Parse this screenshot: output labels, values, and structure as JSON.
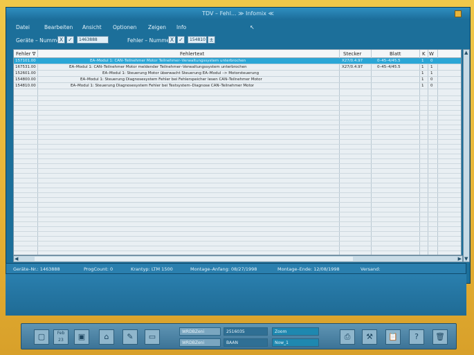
{
  "window": {
    "title": "TDV – Fehl... ≫ Infomix ≪"
  },
  "menu": [
    "Datei",
    "Bearbeiten",
    "Ansicht",
    "Optionen",
    "Zeigen",
    "Info"
  ],
  "filter": {
    "geraete_label": "Geräte – Nummer",
    "geraete_value": "1463888",
    "fehler_label": "Fehler – Nummer",
    "fehler_value": "154810",
    "check_mark": "✓",
    "x_mark": "X"
  },
  "table": {
    "headers": {
      "fehler": "Fehler ∇",
      "text": "Fehlertext",
      "stecker": "Stecker",
      "blatt": "Blatt",
      "k": "K",
      "w": "W"
    },
    "rows": [
      {
        "id": "157101.00",
        "text": "EA–Modul 1: CAN–Teilnehmer Motor Teilnehmer–Verwaltungssystem unterbrochen",
        "stecker": "X27/0.4.97",
        "blatt": "0–45–4/45.5",
        "k": "1",
        "w": "0",
        "selected": true
      },
      {
        "id": "167531.00",
        "text": "EA–Modul 1: CAN–Teilnehmer Motor meldender Teilnehmer–Verwaltungssystem unterbrochen",
        "stecker": "X27/0.4.97",
        "blatt": "0–45–4/45.5",
        "k": "1",
        "w": "1",
        "selected": false
      },
      {
        "id": "152601.00",
        "text": "EA–Modul 1: Steuerung Motor überwacht Steuerung EA–Modul –> Motorsteuerung",
        "stecker": "",
        "blatt": "",
        "k": "1",
        "w": "1",
        "selected": false
      },
      {
        "id": "154800.00",
        "text": "EA–Modul 1: Steuerung Diagnosesystem Fehler bei Fehlerspeicher lesen CAN–Teilnehmer Motor",
        "stecker": "",
        "blatt": "",
        "k": "1",
        "w": "0",
        "selected": false
      },
      {
        "id": "154810.00",
        "text": "EA–Modul 1: Steuerung Diagnosesystem Fehler bei Testsystem–Diagnose CAN–Teilnehmer Motor",
        "stecker": "",
        "blatt": "",
        "k": "1",
        "w": "0",
        "selected": false
      }
    ]
  },
  "status": {
    "geraete": "Geräte–Nr.: 1463888",
    "progcount": "ProgCount: 0",
    "krantyp": "Krantyp: LTM 1500",
    "montage_anfang": "Montage–Anfang: 08/27/1998",
    "montage_ende": "Montage–Ende: 12/08/1998",
    "versand": "Versand:"
  },
  "taskbar": {
    "date_label": "Feb 23",
    "fields": [
      "WRDBZeni",
      "2516035",
      "Zoom",
      "WRDBZeni",
      "BAAN",
      "Now_1"
    ]
  },
  "colors": {
    "screen": "#1c6f9a",
    "selected_row": "#2aa6d6",
    "bezel": "#e8b63a"
  }
}
